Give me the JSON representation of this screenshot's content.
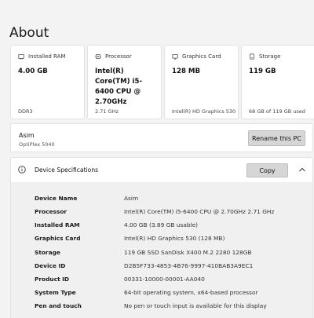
{
  "page": {
    "title": "About"
  },
  "cards": [
    {
      "label": "Installed RAM",
      "value": "4.00 GB",
      "sub": "DDR3",
      "icon": "ram-icon"
    },
    {
      "label": "Processor",
      "value": "Intel(R) Core(TM) i5-6400 CPU @ 2.70GHz",
      "sub": "2.71 GHz",
      "icon": "processor-icon"
    },
    {
      "label": "Graphics Card",
      "value": "128 MB",
      "sub": "Intel(R) HD Graphics 530",
      "icon": "graphics-card-icon"
    },
    {
      "label": "Storage",
      "value": "119 GB",
      "sub": "68 GB of 119 GB used",
      "icon": "storage-icon"
    }
  ],
  "device": {
    "name": "Asim",
    "model": "OptiPlex 5040",
    "rename_label": "Rename this PC"
  },
  "specs": {
    "title": "Device Specifications",
    "copy_label": "Copy",
    "rows": [
      {
        "label": "Device Name",
        "value": "Asim"
      },
      {
        "label": "Processor",
        "value": "Intel(R) Core(TM) i5-6400 CPU @ 2.70GHz   2.71 GHz"
      },
      {
        "label": "Installed RAM",
        "value": "4.00 GB (3.89 GB usable)"
      },
      {
        "label": "Graphics Card",
        "value": "Intel(R) HD Graphics 530 (128 MB)"
      },
      {
        "label": "Storage",
        "value": "119 GB SSD SanDisk X400 M.2 2280 128GB"
      },
      {
        "label": "Device ID",
        "value": "D2B5F733-4853-4B76-9997-410BAB3A9EC1"
      },
      {
        "label": "Product ID",
        "value": "00331-10000-00001-AA040"
      },
      {
        "label": "System Type",
        "value": "64-bit operating system, x64-based processor"
      },
      {
        "label": "Pen and touch",
        "value": "No pen or touch input is available for this display"
      }
    ]
  }
}
